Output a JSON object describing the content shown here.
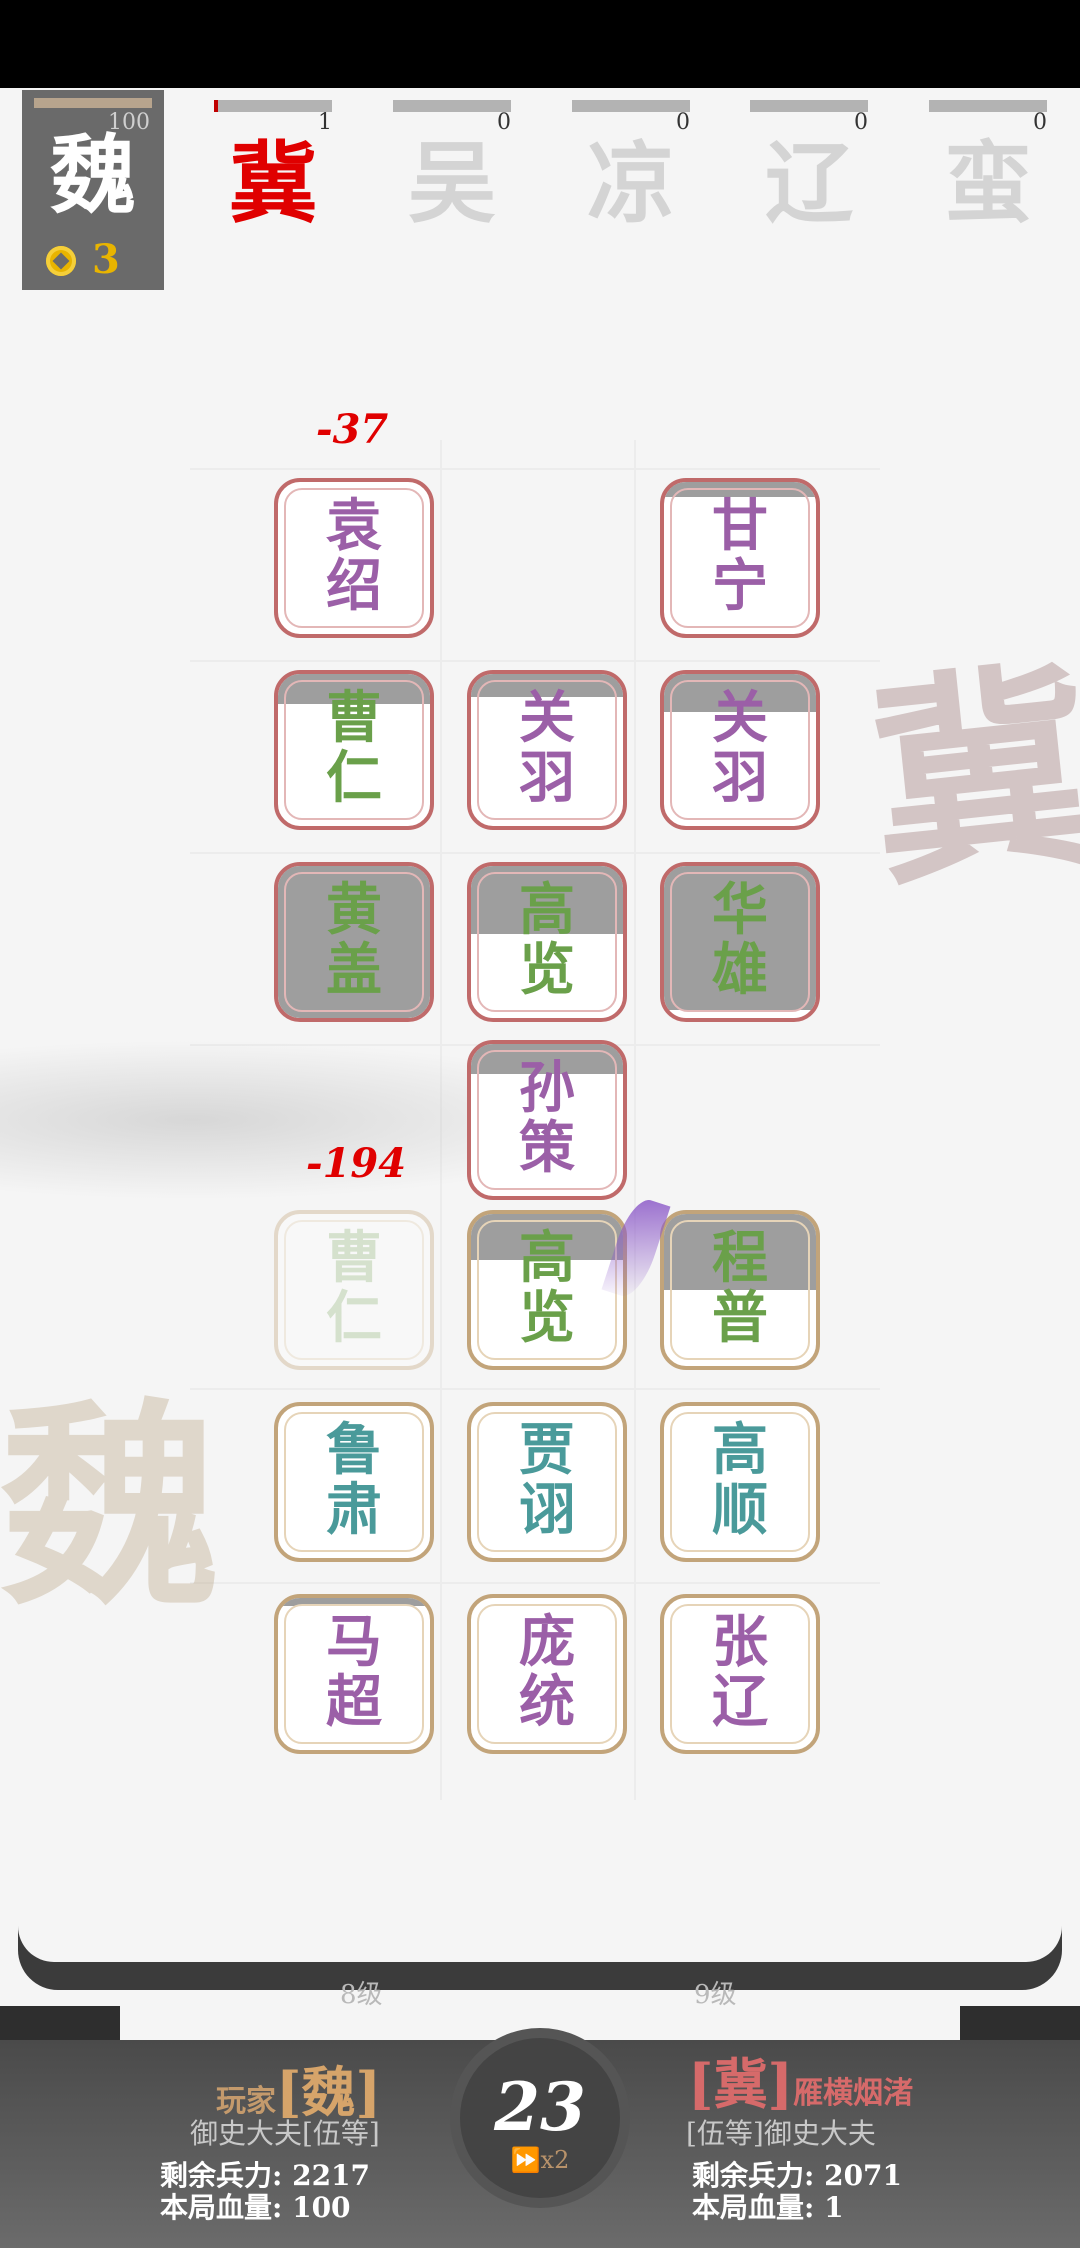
{
  "player": {
    "glyph": "魏",
    "hp": "100",
    "coins": "3"
  },
  "enemies": [
    {
      "glyph": "冀",
      "count": "1",
      "active": true
    },
    {
      "glyph": "吴",
      "count": "0",
      "active": false
    },
    {
      "glyph": "凉",
      "count": "0",
      "active": false
    },
    {
      "glyph": "辽",
      "count": "0",
      "active": false
    },
    {
      "glyph": "蛮",
      "count": "0",
      "active": false
    }
  ],
  "watermarks": {
    "enemy": "冀",
    "player": "魏"
  },
  "damage": {
    "top": "-37",
    "bottom": "-194"
  },
  "tiles": {
    "yuanshao": {
      "line1": "袁",
      "line2": "绍",
      "color": "#9b5fa7",
      "health": 1.0
    },
    "ganning": {
      "line1": "甘",
      "line2": "宁",
      "color": "#9b5fa7",
      "health": 0.9
    },
    "caoren_e": {
      "line1": "曹",
      "line2": "仁",
      "color": "#6aa04a",
      "health": 0.8
    },
    "guanyu_1": {
      "line1": "关",
      "line2": "羽",
      "color": "#9b5fa7",
      "health": 0.85
    },
    "guanyu_2": {
      "line1": "关",
      "line2": "羽",
      "color": "#9b5fa7",
      "health": 0.75
    },
    "huanggai": {
      "line1": "黄",
      "line2": "盖",
      "color": "#6aa04a",
      "health": 0.0
    },
    "gaolan_e": {
      "line1": "高",
      "line2": "览",
      "color": "#6aa04a",
      "health": 0.55
    },
    "huaxiong": {
      "line1": "华",
      "line2": "雄",
      "color": "#6aa04a",
      "health": 0.05
    },
    "sunce": {
      "line1": "孙",
      "line2": "策",
      "color": "#9b5fa7",
      "health": 0.8
    },
    "caoren_p": {
      "line1": "曹",
      "line2": "仁",
      "color": "#9bbd86",
      "health": 1.0
    },
    "gaolan_p": {
      "line1": "高",
      "line2": "览",
      "color": "#6aa04a",
      "health": 0.7
    },
    "chengpu": {
      "line1": "程",
      "line2": "普",
      "color": "#6aa04a",
      "health": 0.5
    },
    "lusu": {
      "line1": "鲁",
      "line2": "肃",
      "color": "#4a9a9a",
      "health": 1.0
    },
    "jiaxu": {
      "line1": "贾",
      "line2": "诩",
      "color": "#4a9a9a",
      "health": 1.0
    },
    "gaoshun": {
      "line1": "高",
      "line2": "顺",
      "color": "#4a9a9a",
      "health": 1.0
    },
    "machao": {
      "line1": "马",
      "line2": "超",
      "color": "#9b5fa7",
      "health": 0.95
    },
    "pangtong": {
      "line1": "庞",
      "line2": "统",
      "color": "#9b5fa7",
      "health": 1.0
    },
    "zhangliao": {
      "line1": "张",
      "line2": "辽",
      "color": "#9b5fa7",
      "health": 1.0
    }
  },
  "levels": {
    "left": "8级",
    "right": "9级"
  },
  "turn": {
    "number": "23",
    "speed": "x2"
  },
  "left_side": {
    "prefix": "玩家",
    "faction": "[魏]",
    "rank": "御史大夫[伍等]",
    "troops_label": "剩余兵力:",
    "troops": "2217",
    "hp_label": "本局血量:",
    "hp": "100"
  },
  "right_side": {
    "faction": "[冀]",
    "name": "雁横烟渚",
    "rank": "[伍等]御史大夫",
    "troops_label": "剩余兵力:",
    "troops": "2071",
    "hp_label": "本局血量:",
    "hp": "1"
  },
  "colors": {
    "enemy_active": "#e00000",
    "coin": "#e8b400",
    "red_border": "#c06a6a",
    "gold_border": "#c2a47a"
  }
}
